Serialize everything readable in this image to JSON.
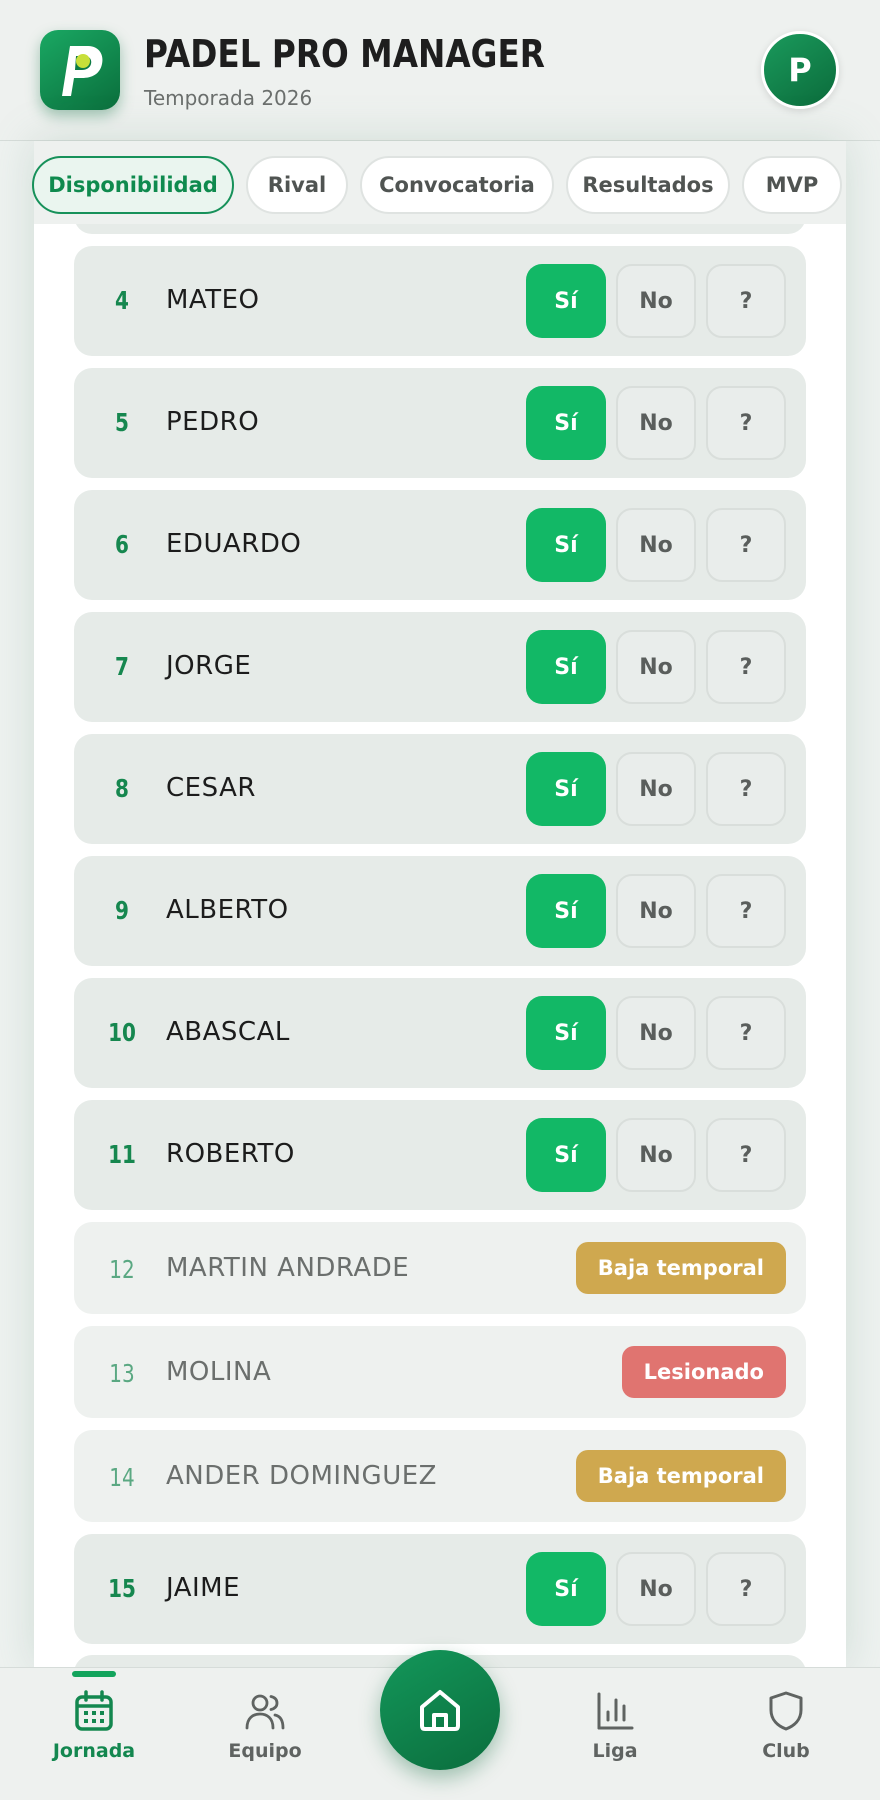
{
  "header": {
    "title": "PADEL PRO MANAGER",
    "subtitle": "Temporada 2026",
    "avatar_initial": "P",
    "logo_letter": "P"
  },
  "tabs": [
    {
      "label": "Disponibilidad",
      "active": true
    },
    {
      "label": "Rival",
      "active": false
    },
    {
      "label": "Convocatoria",
      "active": false
    },
    {
      "label": "Resultados",
      "active": false
    },
    {
      "label": "MVP",
      "active": false
    }
  ],
  "players": [
    {
      "num": "4",
      "name": "MATEO",
      "yes": "Sí",
      "no": "No",
      "maybe": "?"
    },
    {
      "num": "5",
      "name": "PEDRO",
      "yes": "Sí",
      "no": "No",
      "maybe": "?"
    },
    {
      "num": "6",
      "name": "EDUARDO",
      "yes": "Sí",
      "no": "No",
      "maybe": "?"
    },
    {
      "num": "7",
      "name": "JORGE",
      "yes": "Sí",
      "no": "No",
      "maybe": "?"
    },
    {
      "num": "8",
      "name": "CESAR",
      "yes": "Sí",
      "no": "No",
      "maybe": "?"
    },
    {
      "num": "9",
      "name": "ALBERTO",
      "yes": "Sí",
      "no": "No",
      "maybe": "?"
    },
    {
      "num": "10",
      "name": "ABASCAL",
      "yes": "Sí",
      "no": "No",
      "maybe": "?"
    },
    {
      "num": "11",
      "name": "ROBERTO",
      "yes": "Sí",
      "no": "No",
      "maybe": "?"
    }
  ],
  "unavailable": [
    {
      "num": "12",
      "name": "MARTIN ANDRADE",
      "status": "Baja temporal"
    },
    {
      "num": "13",
      "name": "MOLINA",
      "status": "Lesionado"
    },
    {
      "num": "14",
      "name": "ANDER DOMINGUEZ",
      "status": "Baja temporal"
    }
  ],
  "player15": {
    "num": "15",
    "name": "JAIME",
    "yes": "Sí",
    "no": "No",
    "maybe": "?"
  },
  "colors": {
    "accent": "#12b866",
    "brand": "#0f8a4e",
    "baja": "#cfa84f",
    "lesionado": "#e07470"
  },
  "bottom_nav": {
    "jornada": "Jornada",
    "equipo": "Equipo",
    "liga": "Liga",
    "club": "Club"
  }
}
